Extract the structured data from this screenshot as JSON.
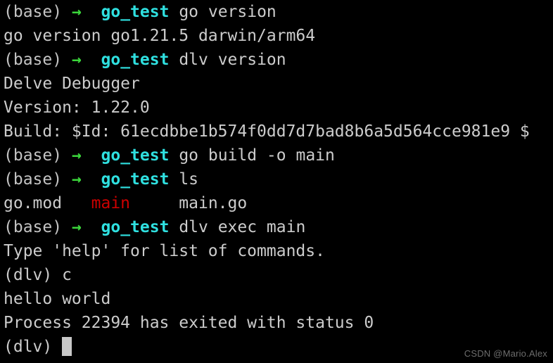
{
  "terminal": {
    "background_color": "#000000",
    "foreground_color": "#cccccc",
    "prompt": {
      "env_label": "(base)",
      "arrow_glyph": "→",
      "directory": "go_test",
      "env_color": "#c3c3c3",
      "arrow_color": "#3bd63b",
      "directory_color": "#2fe0e0"
    },
    "dlv_prompt": "(dlv)",
    "cursor": {
      "shape": "block",
      "color": "#c8c8c8",
      "visible": true
    },
    "lines": [
      {
        "type": "command",
        "env": "(base)",
        "arrow": "→",
        "dir": "go_test",
        "command": "go version"
      },
      {
        "type": "output",
        "text": "go version go1.21.5 darwin/arm64"
      },
      {
        "type": "command",
        "env": "(base)",
        "arrow": "→",
        "dir": "go_test",
        "command": "dlv version"
      },
      {
        "type": "output",
        "text": "Delve Debugger"
      },
      {
        "type": "output",
        "text": "Version: 1.22.0"
      },
      {
        "type": "output",
        "text": "Build: $Id: 61ecdbbe1b574f0dd7d7bad8b6a5d564cce981e9 $"
      },
      {
        "type": "command",
        "env": "(base)",
        "arrow": "→",
        "dir": "go_test",
        "command": "go build -o main"
      },
      {
        "type": "command",
        "env": "(base)",
        "arrow": "→",
        "dir": "go_test",
        "command": "ls"
      },
      {
        "type": "ls-output",
        "files": [
          {
            "name": "go.mod",
            "color": "#cccccc",
            "executable": false
          },
          {
            "name": "main",
            "color": "#cc0000",
            "executable": true
          },
          {
            "name": "main.go",
            "color": "#cccccc",
            "executable": false
          }
        ]
      },
      {
        "type": "command",
        "env": "(base)",
        "arrow": "→",
        "dir": "go_test",
        "command": "dlv exec main"
      },
      {
        "type": "output",
        "text": "Type 'help' for list of commands."
      },
      {
        "type": "dlv-command",
        "prompt": "(dlv)",
        "command": "c"
      },
      {
        "type": "output",
        "text": "hello world"
      },
      {
        "type": "output",
        "text": "Process 22394 has exited with status 0"
      },
      {
        "type": "dlv-prompt-cursor",
        "prompt": "(dlv)"
      }
    ]
  },
  "watermark": {
    "text": "CSDN @Mario.Alex",
    "color": "#6d6d6d"
  }
}
